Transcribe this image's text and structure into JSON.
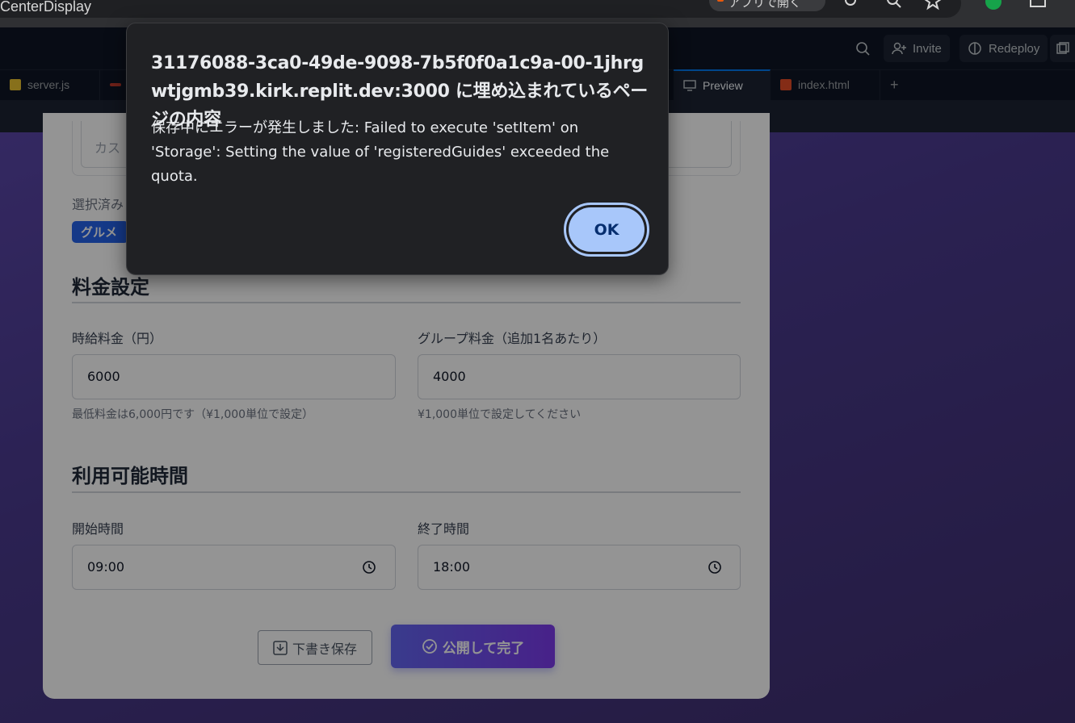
{
  "browser": {
    "url_fragment": "CenterDisplay",
    "app_pill_label": "アプリで開く"
  },
  "replit": {
    "invite_label": "Invite",
    "redeploy_label": "Redeploy",
    "tabs": [
      {
        "label": "server.js"
      },
      {
        "label": "Preview"
      },
      {
        "label": "index.html"
      }
    ],
    "new_tab_symbol": "+"
  },
  "form": {
    "custom_placeholder": "カス",
    "selected_label": "選択済み",
    "selected_chip": "グルメ",
    "pricing": {
      "title": "料金設定",
      "hourly_label": "時給料金（円）",
      "hourly_value": "6000",
      "hourly_hint": "最低料金は6,000円です（¥1,000単位で設定）",
      "group_label": "グループ料金（追加1名あたり）",
      "group_value": "4000",
      "group_hint": "¥1,000単位で設定してください"
    },
    "availability": {
      "title": "利用可能時間",
      "start_label": "開始時間",
      "start_value": "09:00",
      "end_label": "終了時間",
      "end_value": "18:00"
    },
    "draft_button": "下書き保存",
    "publish_button": "公開して完了"
  },
  "dialog": {
    "title": "31176088-3ca0-49de-9098-7b5f0f0a1c9a-00-1jhrgwtjgmb39.kirk.replit.dev:3000 に埋め込まれているページの内容",
    "message": "保存中にエラーが発生しました: Failed to execute 'setItem' on 'Storage': Setting the value of 'registeredGuides' exceeded the quota.",
    "ok_label": "OK"
  },
  "colors": {
    "accent": "#a8c7fa",
    "chip": "#2563eb",
    "publish": "#6366f1"
  }
}
